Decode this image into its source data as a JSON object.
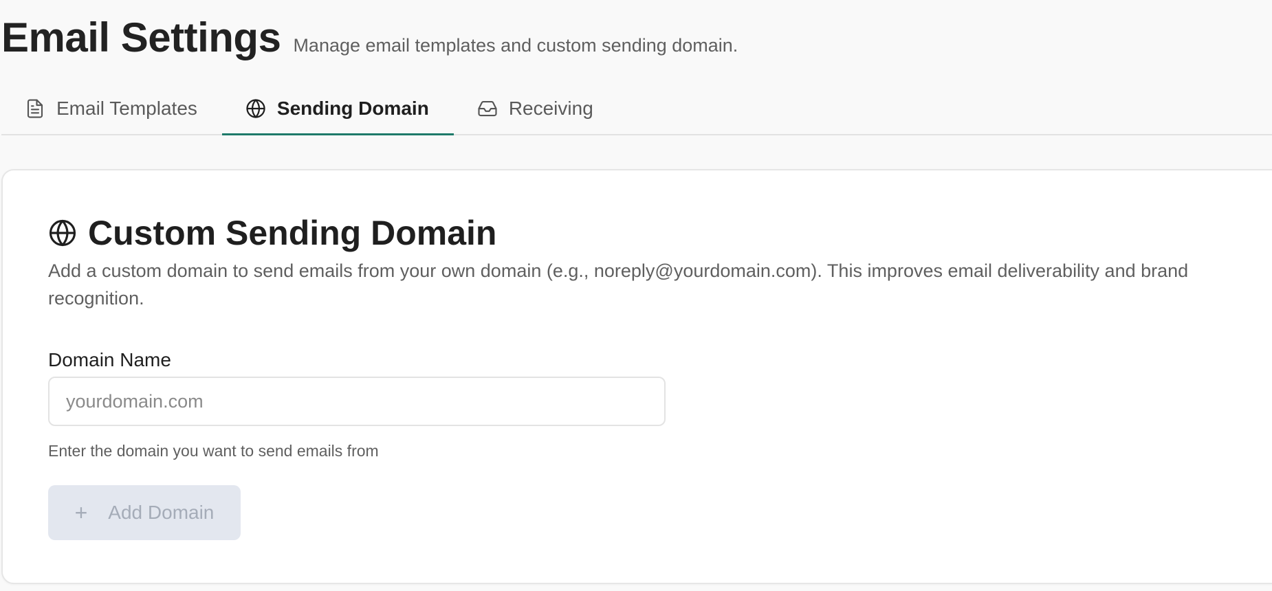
{
  "header": {
    "title": "Email Settings",
    "subtitle": "Manage email templates and custom sending domain."
  },
  "tabs": [
    {
      "label": "Email Templates",
      "icon": "document-icon",
      "active": false
    },
    {
      "label": "Sending Domain",
      "icon": "globe-icon",
      "active": true
    },
    {
      "label": "Receiving",
      "icon": "inbox-icon",
      "active": false
    }
  ],
  "card": {
    "title": "Custom Sending Domain",
    "icon": "globe-icon",
    "description": "Add a custom domain to send emails from your own domain (e.g., noreply@yourdomain.com). This improves email deliverability and brand recognition."
  },
  "form": {
    "domain_label": "Domain Name",
    "domain_placeholder": "yourdomain.com",
    "domain_value": "",
    "helper": "Enter the domain you want to send emails from",
    "add_button_label": "Add Domain",
    "add_button_icon": "plus-icon",
    "add_button_enabled": false
  },
  "colors": {
    "accent": "#1e7a6a",
    "disabled_button_bg": "#e3e7ef",
    "disabled_button_text": "#a5acb8"
  }
}
